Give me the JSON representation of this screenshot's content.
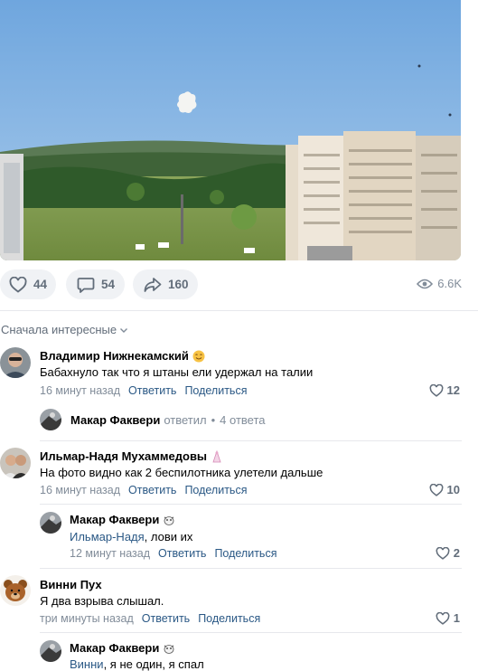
{
  "post": {
    "likes": "44",
    "comments": "54",
    "shares": "160",
    "views": "6.6K"
  },
  "sort_label": "Сначала интересные",
  "comments": [
    {
      "author": "Владимир Нижнекамский",
      "text": "Бабахнуло так что я штаны ели удержал на талии",
      "time": "16 минут назад",
      "reply": "Ответить",
      "share": "Поделиться",
      "likes": "12",
      "thread": {
        "name": "Макар Факвери",
        "verb": "ответил",
        "count": "4 ответа"
      }
    },
    {
      "author": "Ильмар-Надя Мухаммедовы",
      "text": "На фото видно как 2 беспилотника улетели дальше",
      "time": "16 минут назад",
      "reply": "Ответить",
      "share": "Поделиться",
      "likes": "10",
      "answer": {
        "author": "Макар Факвери",
        "mention": "Ильмар-Надя",
        "text": ", лови их",
        "time": "12 минут назад",
        "reply": "Ответить",
        "share": "Поделиться",
        "likes": "2"
      }
    },
    {
      "author": "Винни Пух",
      "text": "Я два взрыва слышал.",
      "time": "три минуты назад",
      "reply": "Ответить",
      "share": "Поделиться",
      "likes": "1",
      "answer": {
        "author": "Макар Факвери",
        "mention": "Винни",
        "text": ", я не один, я спал"
      }
    }
  ],
  "colors": {
    "link": "#2a5885",
    "muted": "#818c99",
    "pill_bg": "#f0f2f5",
    "sky": "#7fb0e0"
  }
}
